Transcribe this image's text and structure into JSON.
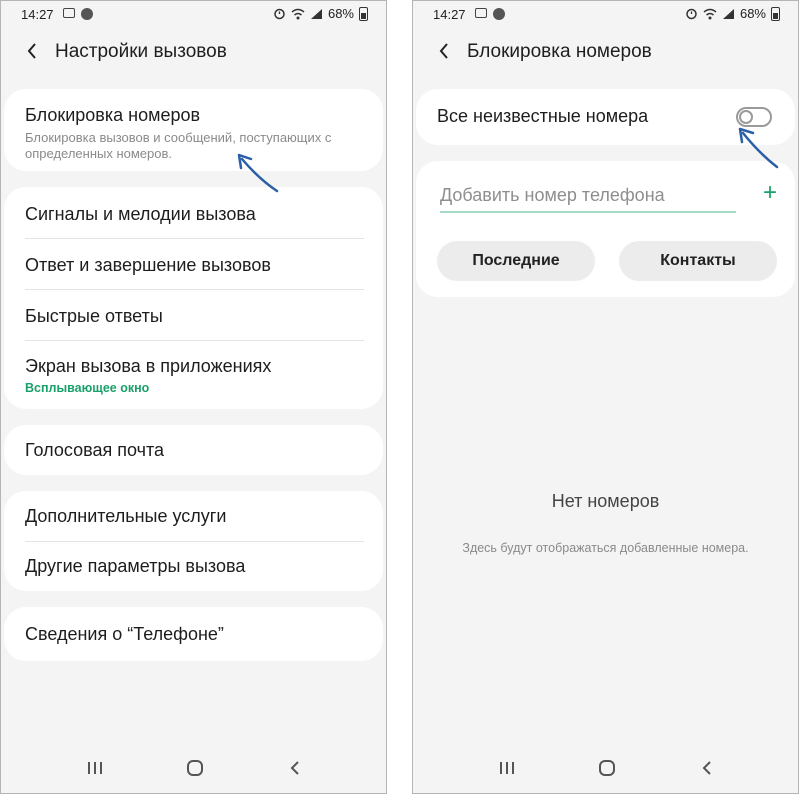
{
  "left": {
    "status": {
      "time": "14:27",
      "battery": "68%"
    },
    "title": "Настройки вызовов",
    "block": {
      "label": "Блокировка номеров",
      "description": "Блокировка вызовов и сообщений, поступающих с определенных номеров."
    },
    "group2": [
      {
        "label": "Сигналы и мелодии вызова"
      },
      {
        "label": "Ответ и завершение вызовов"
      },
      {
        "label": "Быстрые ответы"
      },
      {
        "label": "Экран вызова в приложениях",
        "sub": "Всплывающее окно"
      }
    ],
    "voicemail": "Голосовая почта",
    "group4": [
      "Дополнительные услуги",
      "Другие параметры вызова"
    ],
    "about": "Сведения о “Телефоне”"
  },
  "right": {
    "status": {
      "time": "14:27",
      "battery": "68%"
    },
    "title": "Блокировка номеров",
    "unknown_numbers": {
      "label": "Все неизвестные номера",
      "enabled": false
    },
    "add_number": {
      "placeholder": "Добавить номер телефона",
      "value": ""
    },
    "recent_button": "Последние",
    "contacts_button": "Контакты",
    "empty_title": "Нет номеров",
    "empty_subtitle": "Здесь будут отображаться добавленные номера."
  },
  "colors": {
    "accent": "#1aa06a",
    "annotation_arrow": "#2a5fa8",
    "background": "#f4f4f4",
    "card": "#ffffff"
  },
  "icons": {
    "back": "chevron-left-icon",
    "add": "plus-icon",
    "nav_recent": "recent-apps-icon",
    "nav_home": "home-icon",
    "nav_back": "nav-back-icon"
  }
}
